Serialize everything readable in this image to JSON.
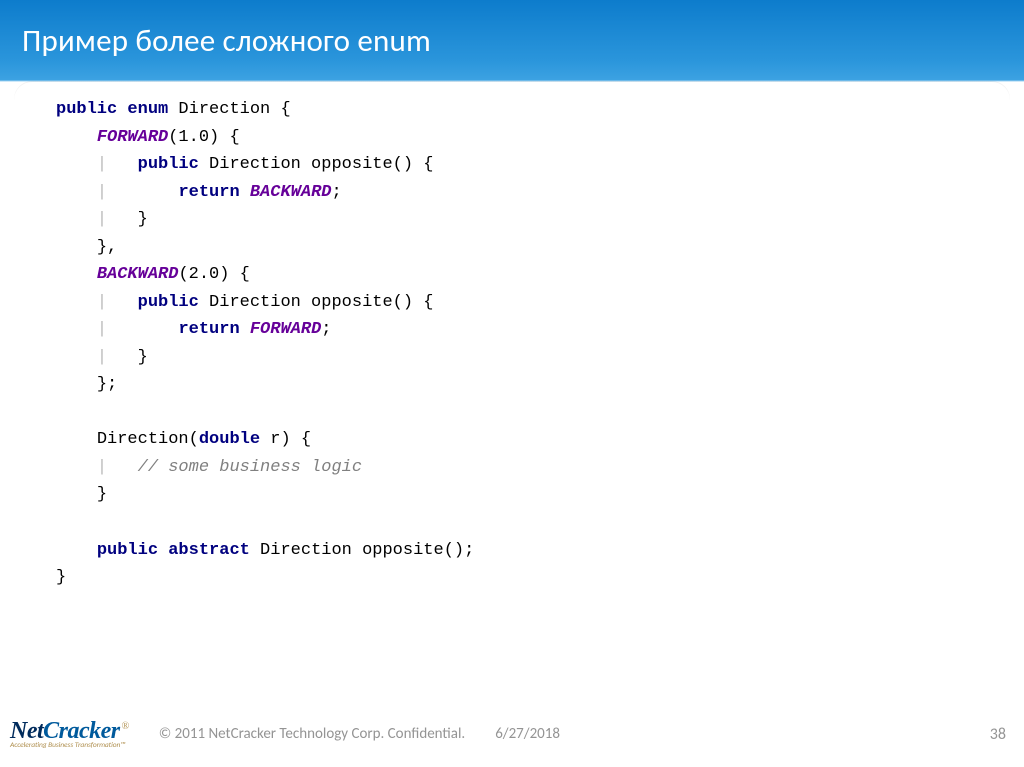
{
  "title": "Пример более сложного enum",
  "code": {
    "l1_kw1": "public",
    "l1_kw2": "enum",
    "l1_rest": " Direction {",
    "l2_enum": "FORWARD",
    "l2_rest": "(1.0) {",
    "l3_kw": "public",
    "l3_rest": " Direction opposite() {",
    "l4_kw": "return",
    "l4_sp": " ",
    "l4_enum": "BACKWARD",
    "l4_semi": ";",
    "close_brace": "}",
    "comma_close": "},",
    "semi_close": "};",
    "l7_enum": "BACKWARD",
    "l7_rest": "(2.0) {",
    "l8_kw": "public",
    "l8_rest": " Direction opposite() {",
    "l9_kw": "return",
    "l9_enum": "FORWARD",
    "ctor_name": "Direction(",
    "ctor_kw": "double",
    "ctor_rest": " r) {",
    "comment": "// some business logic",
    "abs_kw1": "public",
    "abs_kw2": "abstract",
    "abs_rest": " Direction opposite();",
    "guide": "|"
  },
  "footer": {
    "logo_net": "Net",
    "logo_cracker": "Cracker",
    "logo_reg": "®",
    "logo_sub": "Accelerating Business Transformation™",
    "copyright": "© 2011 NetCracker Technology Corp. Confidential.",
    "date": "6/27/2018",
    "page": "38"
  }
}
